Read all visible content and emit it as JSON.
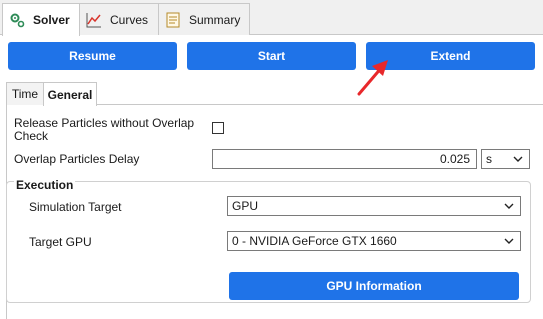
{
  "top_tabs": [
    {
      "label": "Solver",
      "icon": "gears-icon"
    },
    {
      "label": "Curves",
      "icon": "line-chart-icon"
    },
    {
      "label": "Summary",
      "icon": "document-icon"
    }
  ],
  "toolbar": {
    "resume_label": "Resume",
    "start_label": "Start",
    "extend_label": "Extend"
  },
  "sub_tabs": [
    {
      "label": "Time"
    },
    {
      "label": "General"
    }
  ],
  "general": {
    "release_label_line1": "Release Particles without Overlap",
    "release_label_line2": "Check",
    "release_checked": false,
    "delay_label": "Overlap Particles Delay",
    "delay_value": "0.025",
    "delay_unit": "s"
  },
  "execution": {
    "title": "Execution",
    "sim_target_label": "Simulation Target",
    "sim_target_value": "GPU",
    "target_gpu_label": "Target GPU",
    "target_gpu_value": "0 - NVIDIA GeForce GTX 1660",
    "gpu_info_label": "GPU Information"
  },
  "colors": {
    "accent": "#1f73e8",
    "annotation_arrow": "#e8282b"
  }
}
